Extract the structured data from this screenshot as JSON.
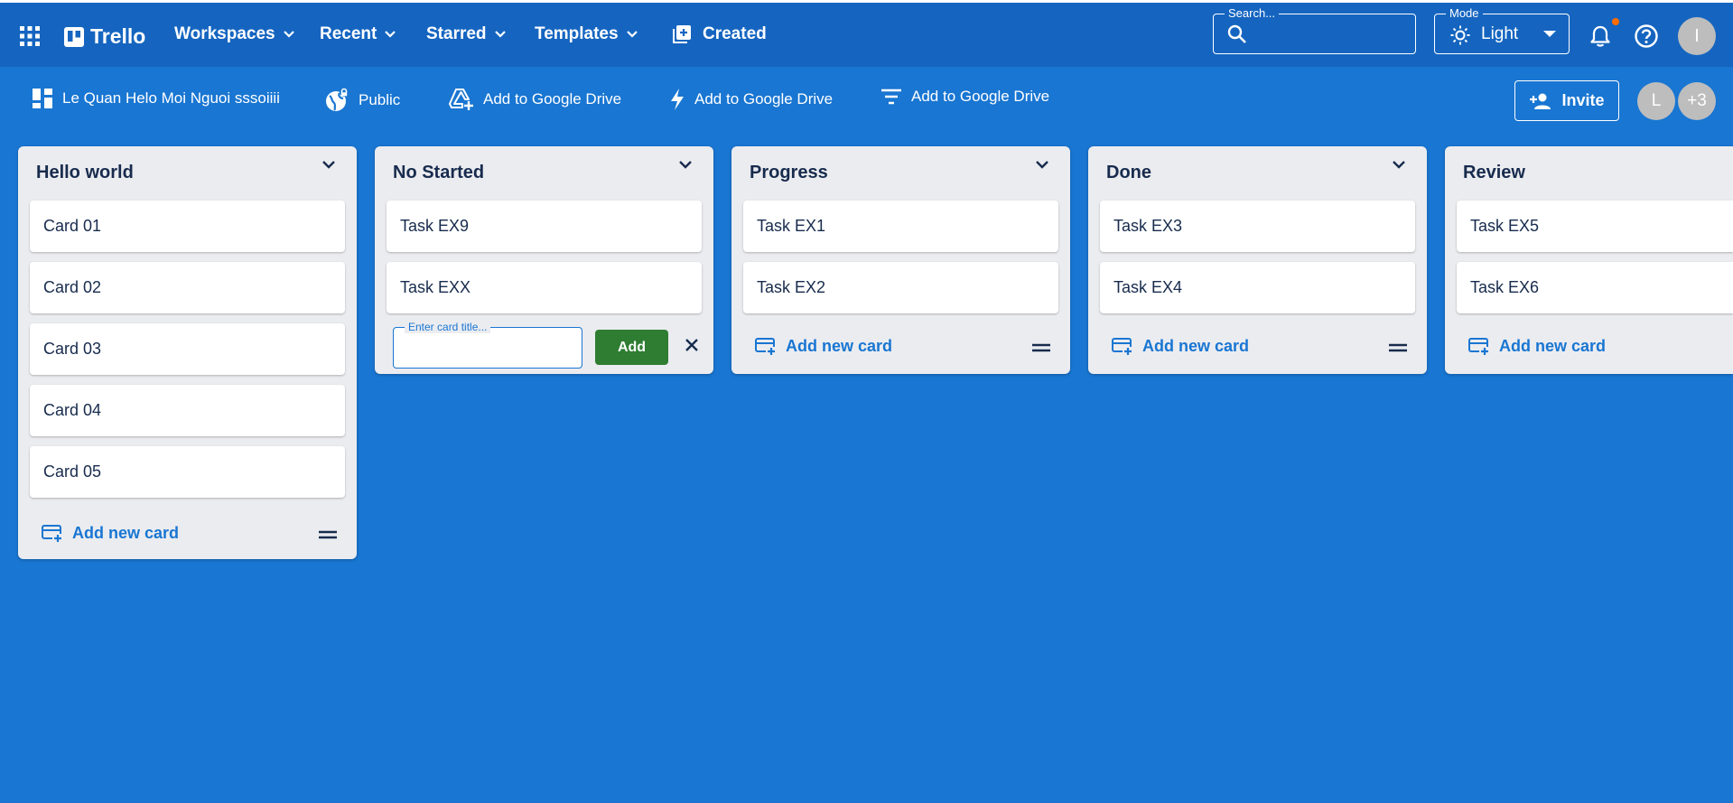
{
  "colors": {
    "background": "#1976d2",
    "topbar": "#1565c0",
    "column": "#ebecf0",
    "add_button": "#2e7d32",
    "link": "#1976d2",
    "notification_dot": "#ff6d00"
  },
  "topbar": {
    "apps_icon": "apps-grid-icon",
    "logo": {
      "icon": "trello-board-icon",
      "text": "Trello"
    },
    "nav": [
      {
        "label": "Workspaces",
        "icon": "chevron-down-icon"
      },
      {
        "label": "Recent",
        "icon": "chevron-down-icon"
      },
      {
        "label": "Starred",
        "icon": "chevron-down-icon"
      },
      {
        "label": "Templates",
        "icon": "chevron-down-icon"
      }
    ],
    "created": {
      "label": "Created",
      "icon": "library-add-icon"
    },
    "search": {
      "label": "Search...",
      "value": "",
      "icon": "search-icon"
    },
    "mode": {
      "label": "Mode",
      "value": "Light",
      "icon": "sun-icon"
    },
    "notifications_icon": "bell-icon",
    "help_icon": "help-icon",
    "user_avatar": "I"
  },
  "boardbar": {
    "board_name": "Le Quan Helo Moi Nguoi sssoiiii",
    "visibility": "Public",
    "actions": [
      {
        "label": "Add to Google Drive",
        "icon": "add-to-drive-icon"
      },
      {
        "label": "Add to Google Drive",
        "icon": "bolt-icon"
      },
      {
        "label": "Add to Google Drive",
        "icon": "filter-list-icon"
      }
    ],
    "invite_label": "Invite",
    "members": [
      "L",
      "+3"
    ]
  },
  "columns": [
    {
      "title": "Hello world",
      "cards": [
        "Card 01",
        "Card 02",
        "Card 03",
        "Card 04",
        "Card 05"
      ],
      "add_label": "Add new card"
    },
    {
      "title": "No Started",
      "cards": [
        "Task EX9",
        "Task EXX"
      ],
      "new_card": {
        "placeholder": "Enter card title...",
        "value": "",
        "add_label": "Add"
      }
    },
    {
      "title": "Progress",
      "cards": [
        "Task EX1",
        "Task EX2"
      ],
      "add_label": "Add new card"
    },
    {
      "title": "Done",
      "cards": [
        "Task EX3",
        "Task EX4"
      ],
      "add_label": "Add new card"
    },
    {
      "title": "Review",
      "cards": [
        "Task EX5",
        "Task EX6"
      ],
      "add_label": "Add new card"
    }
  ]
}
